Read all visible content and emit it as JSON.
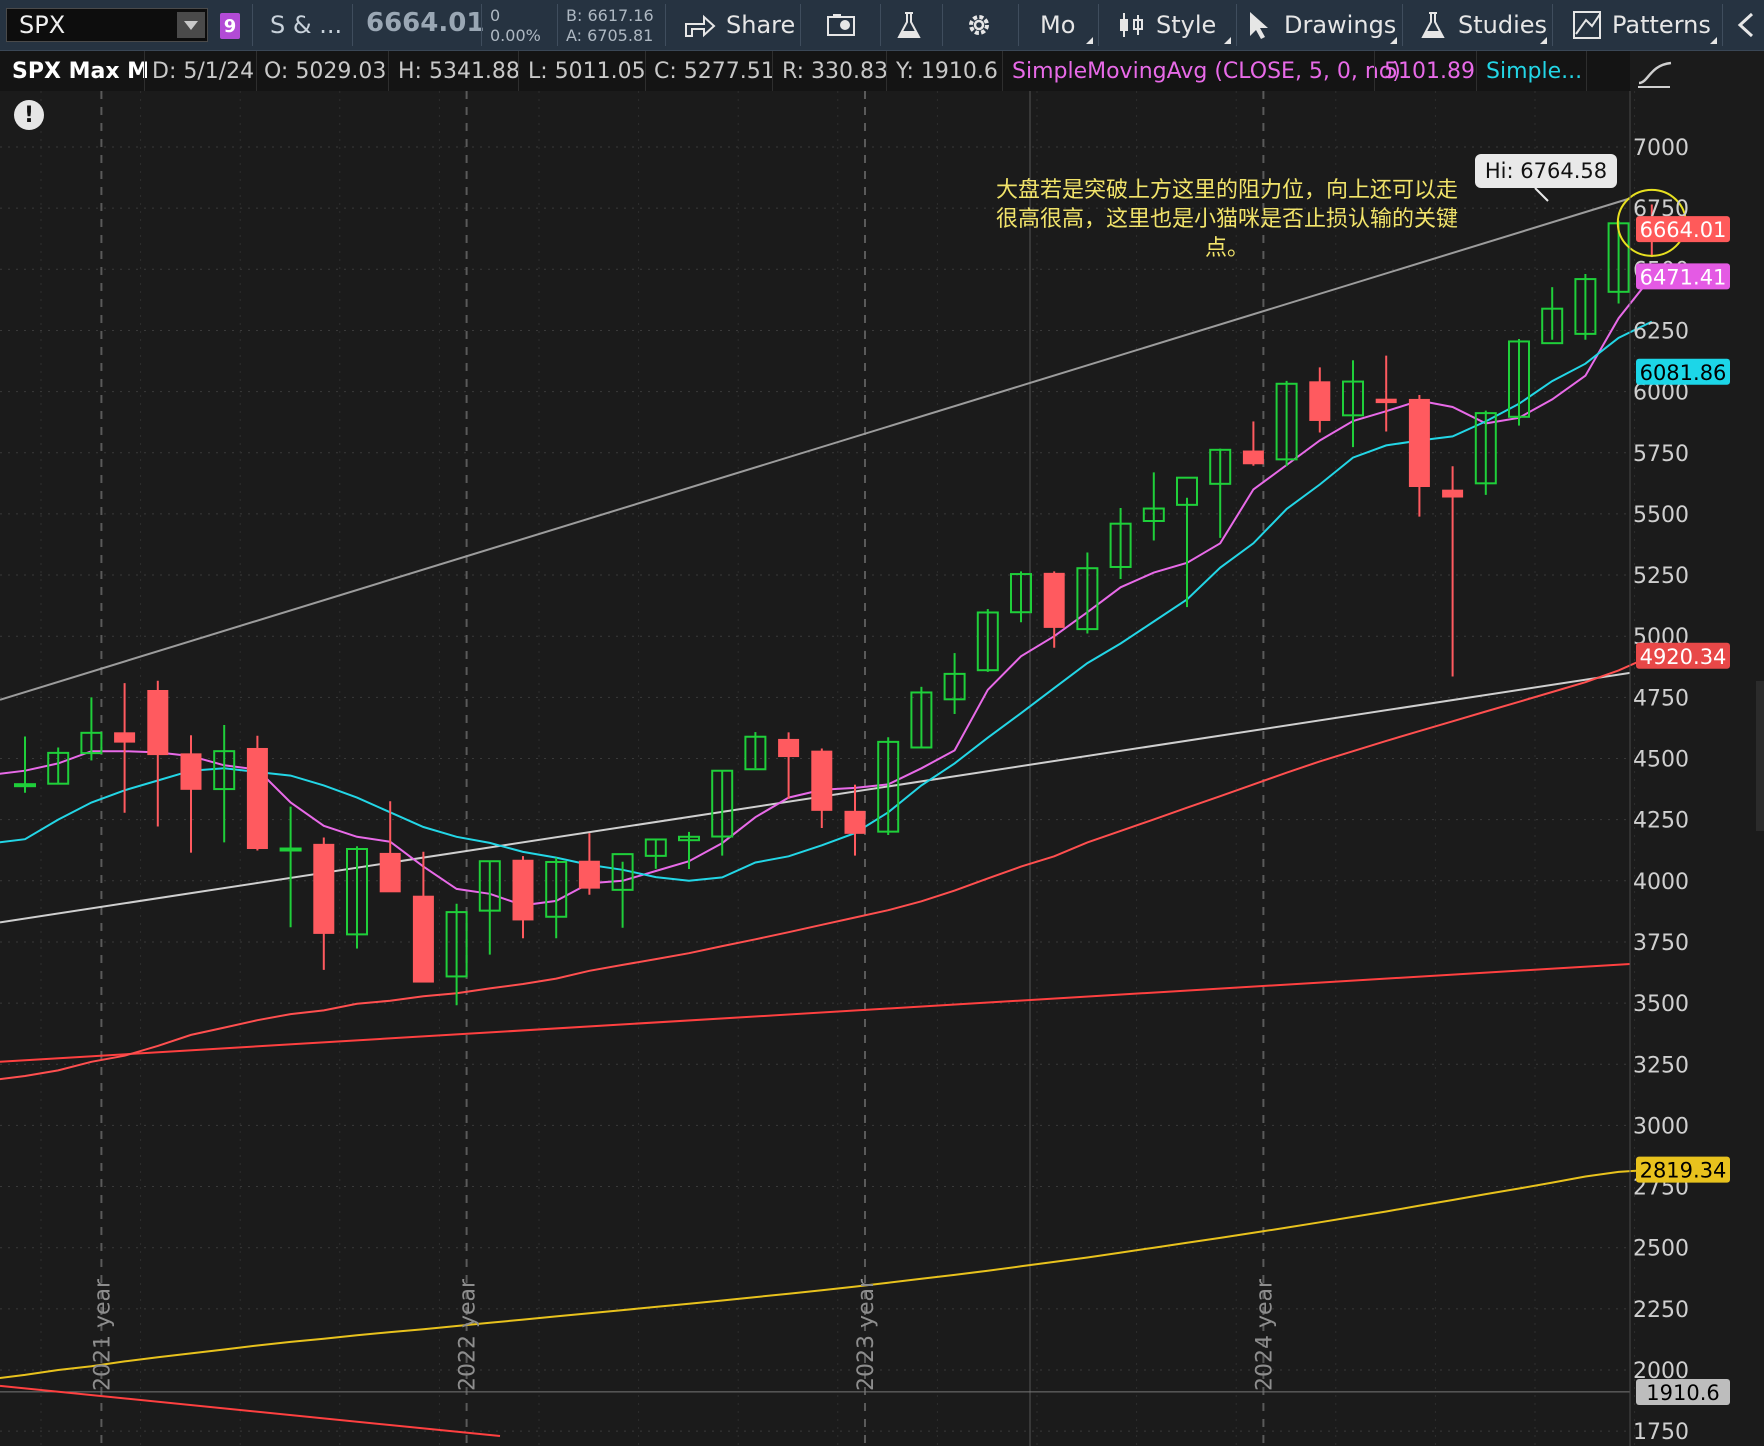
{
  "toolbar": {
    "symbol": "SPX",
    "badge": "9",
    "description": "S & ...",
    "last_price": "6664.01",
    "change": "0",
    "change_pct": "0.00%",
    "bid": "B: 6617.16",
    "ask": "A: 6705.81",
    "share_label": "Share",
    "mo_label": "Mo",
    "style_label": "Style",
    "drawings_label": "Drawings",
    "studies_label": "Studies",
    "patterns_label": "Patterns"
  },
  "infobar": {
    "title": "SPX Max M",
    "date": "D: 5/1/24",
    "open": "O: 5029.03",
    "high": "H: 5341.88",
    "low": "L: 5011.05",
    "close": "C: 5277.51",
    "range": "R: 330.83",
    "y": "Y: 1910.6",
    "study1": "SimpleMovingAvg (CLOSE, 5, 0, no)",
    "study1_value": "5101.89",
    "study2": "Simple...",
    "study1_color": "#e86ae8",
    "study2_color": "#23d6e6"
  },
  "annotation": {
    "lines": [
      "大盘若是突破上方这里的阻力位，向上还可以走",
      "很高很高，这里也是小猫咪是否止损认输的关键",
      "点。"
    ],
    "hi_label": "Hi: 6764.58"
  },
  "chart_data": {
    "type": "candlestick",
    "ylim": [
      1750,
      7250
    ],
    "y_ticks": [
      1750,
      2000,
      2250,
      2500,
      2750,
      3000,
      3250,
      3500,
      3750,
      4000,
      4250,
      4500,
      4750,
      5000,
      5250,
      5500,
      5750,
      6000,
      6250,
      6500,
      6750,
      7000
    ],
    "year_labels": [
      "2021 year",
      "2022 year",
      "2023 year",
      "2024 year"
    ],
    "candles": [
      {
        "o": 4395,
        "h": 4590,
        "l": 4360,
        "c": 4395
      },
      {
        "o": 4397,
        "h": 4545,
        "l": 4395,
        "c": 4523
      },
      {
        "o": 4522,
        "h": 4750,
        "l": 4492,
        "c": 4605
      },
      {
        "o": 4605,
        "h": 4808,
        "l": 4278,
        "c": 4567
      },
      {
        "o": 4778,
        "h": 4818,
        "l": 4222,
        "c": 4516
      },
      {
        "o": 4519,
        "h": 4595,
        "l": 4115,
        "c": 4374
      },
      {
        "o": 4375,
        "h": 4637,
        "l": 4157,
        "c": 4530
      },
      {
        "o": 4541,
        "h": 4593,
        "l": 4124,
        "c": 4132
      },
      {
        "o": 4130,
        "h": 4303,
        "l": 3810,
        "c": 4132
      },
      {
        "o": 4149,
        "h": 4177,
        "l": 3636,
        "c": 3785
      },
      {
        "o": 3781,
        "h": 4141,
        "l": 3723,
        "c": 4130
      },
      {
        "o": 4112,
        "h": 4325,
        "l": 3955,
        "c": 3955
      },
      {
        "o": 3937,
        "h": 4119,
        "l": 3584,
        "c": 3586
      },
      {
        "o": 3609,
        "h": 3906,
        "l": 3491,
        "c": 3872
      },
      {
        "o": 3878,
        "h": 4081,
        "l": 3698,
        "c": 4080
      },
      {
        "o": 4084,
        "h": 4101,
        "l": 3765,
        "c": 3840
      },
      {
        "o": 3853,
        "h": 4095,
        "l": 3765,
        "c": 4077
      },
      {
        "o": 4080,
        "h": 4195,
        "l": 3943,
        "c": 3970
      },
      {
        "o": 3963,
        "h": 4078,
        "l": 3808,
        "c": 4109
      },
      {
        "o": 4102,
        "h": 4170,
        "l": 4049,
        "c": 4169
      },
      {
        "o": 4166,
        "h": 4200,
        "l": 4048,
        "c": 4180
      },
      {
        "o": 4181,
        "h": 4450,
        "l": 4103,
        "c": 4450
      },
      {
        "o": 4456,
        "h": 4608,
        "l": 4460,
        "c": 4589
      },
      {
        "o": 4578,
        "h": 4607,
        "l": 4335,
        "c": 4508
      },
      {
        "o": 4530,
        "h": 4541,
        "l": 4216,
        "c": 4288
      },
      {
        "o": 4284,
        "h": 4393,
        "l": 4103,
        "c": 4194
      },
      {
        "o": 4201,
        "h": 4587,
        "l": 4187,
        "c": 4568
      },
      {
        "o": 4545,
        "h": 4793,
        "l": 4546,
        "c": 4770
      },
      {
        "o": 4742,
        "h": 4931,
        "l": 4682,
        "c": 4846
      },
      {
        "o": 4861,
        "h": 5111,
        "l": 4854,
        "c": 5097
      },
      {
        "o": 5098,
        "h": 5265,
        "l": 5057,
        "c": 5254
      },
      {
        "o": 5257,
        "h": 5265,
        "l": 4953,
        "c": 5036
      },
      {
        "o": 5029,
        "h": 5342,
        "l": 5011,
        "c": 5278
      },
      {
        "o": 5283,
        "h": 5524,
        "l": 5234,
        "c": 5460
      },
      {
        "o": 5471,
        "h": 5670,
        "l": 5391,
        "c": 5522
      },
      {
        "o": 5537,
        "h": 5566,
        "l": 5119,
        "c": 5648
      },
      {
        "o": 5623,
        "h": 5767,
        "l": 5402,
        "c": 5762
      },
      {
        "o": 5757,
        "h": 5878,
        "l": 5697,
        "c": 5705
      },
      {
        "o": 5723,
        "h": 6044,
        "l": 5696,
        "c": 6032
      },
      {
        "o": 6040,
        "h": 6099,
        "l": 5833,
        "c": 5882
      },
      {
        "o": 5903,
        "h": 6128,
        "l": 5773,
        "c": 6041
      },
      {
        "o": 5969,
        "h": 6147,
        "l": 5837,
        "c": 5955
      },
      {
        "o": 5968,
        "h": 5986,
        "l": 5489,
        "c": 5612
      },
      {
        "o": 5597,
        "h": 5695,
        "l": 4835,
        "c": 5569
      },
      {
        "o": 5625,
        "h": 5922,
        "l": 5578,
        "c": 5912
      },
      {
        "o": 5897,
        "h": 6215,
        "l": 5861,
        "c": 6205
      },
      {
        "o": 6198,
        "h": 6427,
        "l": 6212,
        "c": 6339
      },
      {
        "o": 6236,
        "h": 6481,
        "l": 6212,
        "c": 6460
      },
      {
        "o": 6408,
        "h": 6699,
        "l": 6360,
        "c": 6688
      },
      {
        "o": 6700,
        "h": 6765,
        "l": 6550,
        "c": 6664
      }
    ],
    "series": [
      {
        "name": "SimpleMovingAvg (CLOSE, 5, 0, no)",
        "color": "#e86ae8",
        "values": [
          4450,
          4480,
          4530,
          4530,
          4525,
          4510,
          4472,
          4455,
          4320,
          4225,
          4180,
          4160,
          4058,
          3967,
          3947,
          3900,
          3918,
          3990,
          4000,
          4040,
          4080,
          4154,
          4260,
          4340,
          4372,
          4380,
          4394,
          4460,
          4533,
          4781,
          4918,
          5000,
          5098,
          5200,
          5260,
          5300,
          5380,
          5600,
          5700,
          5800,
          5880,
          5920,
          5963,
          5937,
          5870,
          5893,
          5968,
          6065,
          6300,
          6471
        ]
      },
      {
        "name": "Simple...",
        "color": "#23d6e6",
        "values": [
          4170,
          4250,
          4320,
          4370,
          4410,
          4450,
          4460,
          4445,
          4430,
          4390,
          4340,
          4280,
          4220,
          4180,
          4155,
          4118,
          4095,
          4065,
          4045,
          4015,
          4000,
          4014,
          4075,
          4100,
          4145,
          4195,
          4280,
          4390,
          4480,
          4585,
          4685,
          4788,
          4890,
          4970,
          5060,
          5150,
          5280,
          5380,
          5520,
          5620,
          5730,
          5780,
          5800,
          5817,
          5878,
          5950,
          6043,
          6114,
          6220,
          6286
        ]
      },
      {
        "name": "",
        "color": "#ff4f4f",
        "values": [
          3202,
          3225,
          3260,
          3285,
          3325,
          3370,
          3400,
          3430,
          3455,
          3470,
          3497,
          3510,
          3528,
          3540,
          3560,
          3578,
          3600,
          3632,
          3656,
          3680,
          3704,
          3733,
          3761,
          3790,
          3820,
          3850,
          3880,
          3916,
          3960,
          4010,
          4058,
          4100,
          4157,
          4204,
          4251,
          4299,
          4346,
          4394,
          4442,
          4488,
          4530,
          4572,
          4612,
          4652,
          4692,
          4732,
          4772,
          4812,
          4860,
          4920
        ]
      },
      {
        "name": "",
        "color": "#e8c21d",
        "values": [
          1980,
          2000,
          2015,
          2035,
          2052,
          2068,
          2084,
          2100,
          2115,
          2128,
          2142,
          2155,
          2167,
          2180,
          2193,
          2206,
          2219,
          2232,
          2245,
          2258,
          2271,
          2284,
          2298,
          2312,
          2326,
          2341,
          2357,
          2373,
          2389,
          2406,
          2424,
          2442,
          2460,
          2480,
          2500,
          2520,
          2540,
          2561,
          2582,
          2604,
          2626,
          2648,
          2672,
          2695,
          2719,
          2742,
          2766,
          2791,
          2810,
          2819
        ]
      }
    ],
    "price_labels": [
      {
        "value": "6664.01",
        "color": "#ff5a5a",
        "text_color": "#ffffff",
        "price": 6664
      },
      {
        "value": "6471.41",
        "color": "#e45ae4",
        "text_color": "#ffffff",
        "price": 6471
      },
      {
        "value": "6081.86",
        "color": "#1cd6e8",
        "text_color": "#000000",
        "price": 6081
      },
      {
        "value": "4920.34",
        "color": "#e84848",
        "text_color": "#ffffff",
        "price": 4920
      },
      {
        "value": "2819.34",
        "color": "#e8c21d",
        "text_color": "#000000",
        "price": 2819
      },
      {
        "value": "1910.6",
        "color": "#bdbdbd",
        "text_color": "#000000",
        "price": 1910
      }
    ]
  }
}
